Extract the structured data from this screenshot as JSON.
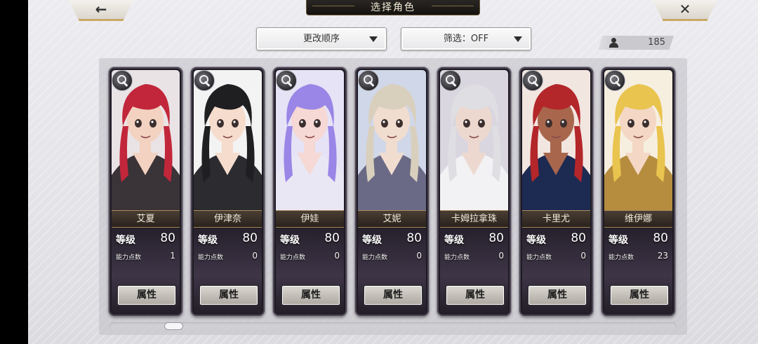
{
  "header": {
    "title": "选择角色",
    "back_icon": "left-arrow-icon",
    "close_icon": "close-x-icon"
  },
  "toolbar": {
    "sort_label": "更改顺序",
    "filter_label": "筛选：OFF",
    "character_count": "185"
  },
  "colors": {
    "card_frame": "#1d1a22",
    "name_band": "#4a3e34",
    "gold_trim": "#a68a5c",
    "accent_border": "#c8a867"
  },
  "characters": [
    {
      "name": "艾夏",
      "level_label": "等级",
      "level": "80",
      "ap_label": "能力点数",
      "ap": "1",
      "button": "属性",
      "hair": "#c2263a",
      "skin": "#f3d2c1",
      "outfit": "#3a3338",
      "bg": "#e9e3e6"
    },
    {
      "name": "伊津奈",
      "level_label": "等级",
      "level": "80",
      "ap_label": "能力点数",
      "ap": "0",
      "button": "属性",
      "hair": "#1f1f22",
      "skin": "#f6dccc",
      "outfit": "#2b2b30",
      "bg": "#f3f3f3"
    },
    {
      "name": "伊娃",
      "level_label": "等级",
      "level": "80",
      "ap_label": "能力点数",
      "ap": "0",
      "button": "属性",
      "hair": "#9a86e6",
      "skin": "#f6d8d4",
      "outfit": "#e9e7f4",
      "bg": "#e6e3f6"
    },
    {
      "name": "艾妮",
      "level_label": "等级",
      "level": "80",
      "ap_label": "能力点数",
      "ap": "0",
      "button": "属性",
      "hair": "#d9cfbd",
      "skin": "#f1ddd0",
      "outfit": "#6b6a86",
      "bg": "#cfd7e8"
    },
    {
      "name": "卡姆拉拿珠",
      "level_label": "等级",
      "level": "80",
      "ap_label": "能力点数",
      "ap": "0",
      "button": "属性",
      "hair": "#dfdfe3",
      "skin": "#ecd8cf",
      "outfit": "#f2f2f4",
      "bg": "#d9d6df"
    },
    {
      "name": "卡里尤",
      "level_label": "等级",
      "level": "80",
      "ap_label": "能力点数",
      "ap": "0",
      "button": "属性",
      "hair": "#b3262a",
      "skin": "#a8674d",
      "outfit": "#1d2a52",
      "bg": "#f2e6e0"
    },
    {
      "name": "维伊娜",
      "level_label": "等级",
      "level": "80",
      "ap_label": "能力点数",
      "ap": "23",
      "button": "属性",
      "hair": "#e9c44e",
      "skin": "#f4d7c4",
      "outfit": "#b68d3e",
      "bg": "#f6efe0"
    }
  ],
  "scroll": {
    "position": 0.1
  }
}
